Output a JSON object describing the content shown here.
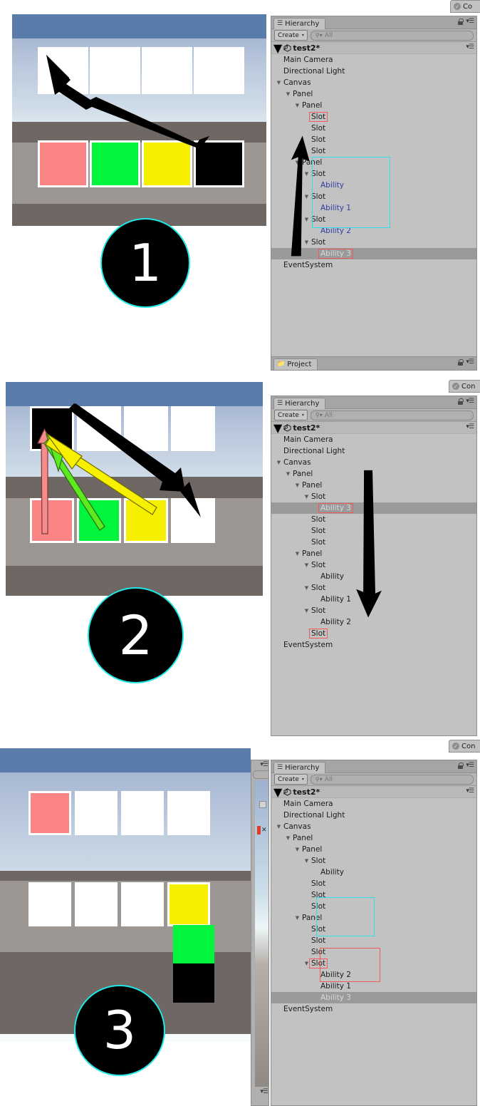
{
  "meta": {
    "app": "Unity Editor",
    "accent_cyan": "#2ee0e8",
    "accent_red": "#f15a5a",
    "panel_bg": "#c2c2c2",
    "selection_bg": "#9a9a9a",
    "ability_text_color": "#2b3fa8"
  },
  "hierarchy_chrome": {
    "tab_label": "Hierarchy",
    "tab_icon": "hierarchy-icon",
    "create_label": "Create",
    "create_caret": "▾",
    "search_placeholder": "All",
    "search_icon": "search-icon",
    "search_value": "",
    "lock_icon": "lock-icon",
    "menu_icon": "panel-menu-icon",
    "scene_name": "test2*",
    "project_tab_label": "Project",
    "project_tab_icon": "folder-icon",
    "inspector_tab_label": "Co",
    "inspector_tab_label_full": "Con",
    "inspector_tab_icon": "checkmark-icon",
    "collapse_caret": "▼"
  },
  "steps": [
    {
      "number": "1",
      "game": {
        "top_row": [
          {
            "name": "slot-0",
            "color": "empty"
          },
          {
            "name": "slot-1",
            "color": "empty"
          },
          {
            "name": "slot-2",
            "color": "empty"
          },
          {
            "name": "slot-3",
            "color": "empty"
          }
        ],
        "bottom_row": [
          {
            "name": "slot-0",
            "color": "pink"
          },
          {
            "name": "slot-1",
            "color": "green"
          },
          {
            "name": "slot-2",
            "color": "yellow"
          },
          {
            "name": "slot-3",
            "color": "black"
          }
        ]
      },
      "tree": [
        {
          "label": "Main Camera",
          "depth": 1,
          "tw": "",
          "kind": "object"
        },
        {
          "label": "Directional Light",
          "depth": 1,
          "tw": "",
          "kind": "object"
        },
        {
          "label": "Canvas",
          "depth": 1,
          "tw": "▼",
          "kind": "object"
        },
        {
          "label": "Panel",
          "depth": 2,
          "tw": "▼",
          "kind": "object"
        },
        {
          "label": "Panel",
          "depth": 3,
          "tw": "▼",
          "kind": "object"
        },
        {
          "label": "Slot",
          "depth": 4,
          "tw": "",
          "kind": "object",
          "mark": "red"
        },
        {
          "label": "Slot",
          "depth": 4,
          "tw": "",
          "kind": "object"
        },
        {
          "label": "Slot",
          "depth": 4,
          "tw": "",
          "kind": "object"
        },
        {
          "label": "Slot",
          "depth": 4,
          "tw": "",
          "kind": "object"
        },
        {
          "label": "Panel",
          "depth": 3,
          "tw": "▼",
          "kind": "object"
        },
        {
          "label": "Slot",
          "depth": 4,
          "tw": "▼",
          "kind": "object"
        },
        {
          "label": "Ability",
          "depth": 5,
          "tw": "",
          "kind": "ability"
        },
        {
          "label": "Slot",
          "depth": 4,
          "tw": "▼",
          "kind": "object"
        },
        {
          "label": "Ability 1",
          "depth": 5,
          "tw": "",
          "kind": "ability"
        },
        {
          "label": "Slot",
          "depth": 4,
          "tw": "▼",
          "kind": "object"
        },
        {
          "label": "Ability 2",
          "depth": 5,
          "tw": "",
          "kind": "ability"
        },
        {
          "label": "Slot",
          "depth": 4,
          "tw": "▼",
          "kind": "object"
        },
        {
          "label": "Ability 3",
          "depth": 5,
          "tw": "",
          "kind": "ability",
          "selected": true,
          "mark": "red"
        },
        {
          "label": "EventSystem",
          "depth": 1,
          "tw": "",
          "kind": "object"
        }
      ],
      "cyan_group": {
        "from": 9,
        "to": 15,
        "note": "second Panel's Slot/Ability group"
      }
    },
    {
      "number": "2",
      "game": {
        "top_row": [
          {
            "name": "slot-0",
            "color": "black"
          },
          {
            "name": "slot-1",
            "color": "empty"
          },
          {
            "name": "slot-2",
            "color": "empty"
          },
          {
            "name": "slot-3",
            "color": "empty"
          }
        ],
        "bottom_row": [
          {
            "name": "slot-0",
            "color": "pink"
          },
          {
            "name": "slot-1",
            "color": "green"
          },
          {
            "name": "slot-2",
            "color": "yellow"
          },
          {
            "name": "slot-3",
            "color": "empty"
          }
        ]
      },
      "tree": [
        {
          "label": "Main Camera",
          "depth": 1,
          "tw": "",
          "kind": "object"
        },
        {
          "label": "Directional Light",
          "depth": 1,
          "tw": "",
          "kind": "object"
        },
        {
          "label": "Canvas",
          "depth": 1,
          "tw": "▼",
          "kind": "object"
        },
        {
          "label": "Panel",
          "depth": 2,
          "tw": "▼",
          "kind": "object"
        },
        {
          "label": "Panel",
          "depth": 3,
          "tw": "▼",
          "kind": "object"
        },
        {
          "label": "Slot",
          "depth": 4,
          "tw": "▼",
          "kind": "object"
        },
        {
          "label": "Ability 3",
          "depth": 5,
          "tw": "",
          "kind": "ability",
          "selected": true,
          "mark": "red"
        },
        {
          "label": "Slot",
          "depth": 4,
          "tw": "",
          "kind": "object"
        },
        {
          "label": "Slot",
          "depth": 4,
          "tw": "",
          "kind": "object"
        },
        {
          "label": "Slot",
          "depth": 4,
          "tw": "",
          "kind": "object"
        },
        {
          "label": "Panel",
          "depth": 3,
          "tw": "▼",
          "kind": "object"
        },
        {
          "label": "Slot",
          "depth": 4,
          "tw": "▼",
          "kind": "object"
        },
        {
          "label": "Ability",
          "depth": 5,
          "tw": "",
          "kind": "ability",
          "dark": true
        },
        {
          "label": "Slot",
          "depth": 4,
          "tw": "▼",
          "kind": "object"
        },
        {
          "label": "Ability 1",
          "depth": 5,
          "tw": "",
          "kind": "ability",
          "dark": true
        },
        {
          "label": "Slot",
          "depth": 4,
          "tw": "▼",
          "kind": "object"
        },
        {
          "label": "Ability 2",
          "depth": 5,
          "tw": "",
          "kind": "ability",
          "dark": true
        },
        {
          "label": "Slot",
          "depth": 4,
          "tw": "",
          "kind": "object",
          "mark": "red"
        },
        {
          "label": "EventSystem",
          "depth": 1,
          "tw": "",
          "kind": "object"
        }
      ]
    },
    {
      "number": "3",
      "game": {
        "top_row": [
          {
            "name": "slot-0",
            "color": "pink"
          },
          {
            "name": "slot-1",
            "color": "empty"
          },
          {
            "name": "slot-2",
            "color": "empty"
          },
          {
            "name": "slot-3",
            "color": "empty"
          }
        ],
        "bottom_row": [
          {
            "name": "slot-0",
            "color": "empty"
          },
          {
            "name": "slot-1",
            "color": "empty"
          },
          {
            "name": "slot-2",
            "color": "empty"
          },
          {
            "name": "slot-3",
            "color": "yellow"
          }
        ],
        "stack": [
          "yellow",
          "green",
          "black"
        ]
      },
      "tree": [
        {
          "label": "Main Camera",
          "depth": 1,
          "tw": "",
          "kind": "object"
        },
        {
          "label": "Directional Light",
          "depth": 1,
          "tw": "",
          "kind": "object"
        },
        {
          "label": "Canvas",
          "depth": 1,
          "tw": "▼",
          "kind": "object"
        },
        {
          "label": "Panel",
          "depth": 2,
          "tw": "▼",
          "kind": "object"
        },
        {
          "label": "Panel",
          "depth": 3,
          "tw": "▼",
          "kind": "object"
        },
        {
          "label": "Slot",
          "depth": 4,
          "tw": "▼",
          "kind": "object"
        },
        {
          "label": "Ability",
          "depth": 5,
          "tw": "",
          "kind": "ability",
          "dark": true
        },
        {
          "label": "Slot",
          "depth": 4,
          "tw": "",
          "kind": "object"
        },
        {
          "label": "Slot",
          "depth": 4,
          "tw": "",
          "kind": "object"
        },
        {
          "label": "Slot",
          "depth": 4,
          "tw": "",
          "kind": "object"
        },
        {
          "label": "Panel",
          "depth": 3,
          "tw": "▼",
          "kind": "object"
        },
        {
          "label": "Slot",
          "depth": 4,
          "tw": "",
          "kind": "object"
        },
        {
          "label": "Slot",
          "depth": 4,
          "tw": "",
          "kind": "object"
        },
        {
          "label": "Slot",
          "depth": 4,
          "tw": "",
          "kind": "object"
        },
        {
          "label": "Slot",
          "depth": 4,
          "tw": "▼",
          "kind": "object",
          "mark": "red"
        },
        {
          "label": "Ability 2",
          "depth": 5,
          "tw": "",
          "kind": "ability",
          "dark": true
        },
        {
          "label": "Ability 1",
          "depth": 5,
          "tw": "",
          "kind": "ability",
          "dark": true
        },
        {
          "label": "Ability 3",
          "depth": 5,
          "tw": "",
          "kind": "ability",
          "selected": true
        },
        {
          "label": "EventSystem",
          "depth": 1,
          "tw": "",
          "kind": "object"
        }
      ],
      "cyan_group": {
        "from": 11,
        "to": 13,
        "note": "three Slots of second Panel"
      }
    }
  ]
}
